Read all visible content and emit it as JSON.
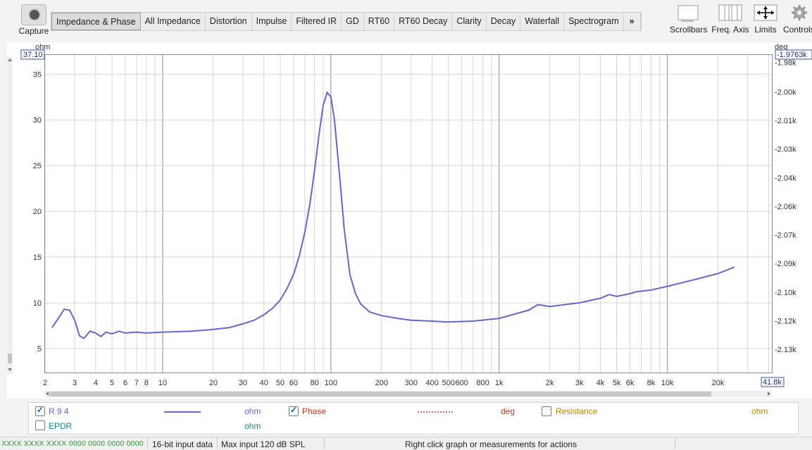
{
  "toolbar": {
    "capture_label": "Capture",
    "tabs": [
      "Impedance & Phase",
      "All Impedance",
      "Distortion",
      "Impulse",
      "Filtered IR",
      "GD",
      "RT60",
      "RT60 Decay",
      "Clarity",
      "Decay",
      "Waterfall",
      "Spectrogram"
    ],
    "more": "»",
    "scrollbars": "Scrollbars",
    "freq_axis": "Freq. Axis",
    "limits": "Limits",
    "controls": "Controls"
  },
  "axes": {
    "left_unit": "ohm",
    "right_unit": "deg",
    "left_top_value": "37.10",
    "right_top_value": "-1.9763k",
    "x_right_value": "41.8k"
  },
  "legend": {
    "r94_label": "R 9 4",
    "r94_unit": "ohm",
    "phase_label": "Phase",
    "phase_unit": "deg",
    "resistance_label": "Resistance",
    "resistance_unit": "ohm",
    "epdr_label": "EPDR",
    "epdr_unit": "ohm"
  },
  "status": {
    "meters": "XXXX XXXX XXXX 0000 0000 0000 0000",
    "input_bits": "16-bit input data",
    "max_input": "Max input 120 dB SPL",
    "hint": "Right click graph or measurements for actions"
  },
  "colors": {
    "impedance": "#6666cc",
    "phase": "#c0392b",
    "resistance": "#b38600",
    "epdr": "#138a8a"
  },
  "chart_data": {
    "type": "line",
    "xscale": "log",
    "xlim": [
      2,
      41800
    ],
    "ylim": [
      2.3,
      37.1
    ],
    "y2lim": [
      -2137.6,
      -1976.3
    ],
    "x_ticks": [
      "2",
      "3",
      "4",
      "5",
      "6",
      "7",
      "8",
      "10",
      "20",
      "30",
      "40",
      "50",
      "60",
      "80",
      "100",
      "200",
      "300",
      "400",
      "500",
      "600",
      "800",
      "1k",
      "2k",
      "3k",
      "4k",
      "5k",
      "6k",
      "8k",
      "10k",
      "20k",
      "4"
    ],
    "x_tick_values": [
      2,
      3,
      4,
      5,
      6,
      7,
      8,
      10,
      20,
      30,
      40,
      50,
      60,
      80,
      100,
      200,
      300,
      400,
      500,
      600,
      800,
      1000,
      2000,
      3000,
      4000,
      5000,
      6000,
      8000,
      10000,
      20000,
      40000
    ],
    "y_ticks": [
      "35",
      "30",
      "25",
      "20",
      "15",
      "10",
      "5"
    ],
    "y_tick_values": [
      35,
      30,
      25,
      20,
      15,
      10,
      5
    ],
    "y2_ticks": [
      "-1.98k",
      "-2.00k",
      "-2.01k",
      "-2.03k",
      "-2.04k",
      "-2.06k",
      "-2.07k",
      "-2.09k",
      "-2.10k",
      "-2.12k",
      "-2.13k"
    ],
    "y2_tick_values": [
      -1980,
      -1995,
      -2009.5,
      -2024,
      -2038.5,
      -2053,
      -2067.5,
      -2082,
      -2096.5,
      -2111,
      -2125.5
    ],
    "grid": true,
    "series": [
      {
        "name": "R 9 4",
        "x": [
          2.2,
          2.4,
          2.6,
          2.8,
          3.0,
          3.2,
          3.4,
          3.7,
          4.0,
          4.3,
          4.6,
          5.0,
          5.5,
          6.0,
          7.0,
          8.0,
          10,
          15,
          20,
          25,
          30,
          35,
          40,
          45,
          50,
          55,
          60,
          65,
          70,
          75,
          80,
          85,
          90,
          95,
          100,
          105,
          110,
          115,
          120,
          130,
          140,
          150,
          170,
          200,
          250,
          300,
          400,
          500,
          700,
          1000,
          1200,
          1500,
          1700,
          2000,
          3000,
          4000,
          4500,
          5000,
          6000,
          6500,
          8000,
          10000,
          15000,
          20000,
          25000
        ],
        "values": [
          7.3,
          8.3,
          9.3,
          9.2,
          8.1,
          6.4,
          6.1,
          6.9,
          6.7,
          6.3,
          6.8,
          6.6,
          6.9,
          6.7,
          6.8,
          6.7,
          6.8,
          6.9,
          7.1,
          7.3,
          7.7,
          8.1,
          8.7,
          9.4,
          10.3,
          11.6,
          13.1,
          15.2,
          17.7,
          20.8,
          24.5,
          28.4,
          31.6,
          33.0,
          32.5,
          30.0,
          26.0,
          22.0,
          18.0,
          13.0,
          11.0,
          9.9,
          9.0,
          8.6,
          8.3,
          8.1,
          8.0,
          7.9,
          8.0,
          8.3,
          8.7,
          9.2,
          9.8,
          9.6,
          10.0,
          10.5,
          10.9,
          10.7,
          11.0,
          11.2,
          11.4,
          11.8,
          12.6,
          13.2,
          13.9
        ]
      },
      {
        "name": "Phase",
        "x": [],
        "values": []
      }
    ]
  }
}
